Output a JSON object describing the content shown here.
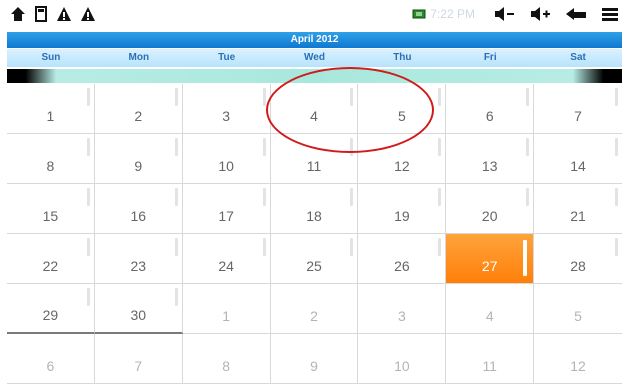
{
  "status_bar": {
    "left_icons": [
      "home-icon",
      "sd-card-icon",
      "warning-icon",
      "warning-icon"
    ],
    "time": "7:22 PM",
    "right_icons": [
      "volume-down-icon",
      "volume-up-icon",
      "back-icon",
      "menu-icon"
    ]
  },
  "calendar": {
    "month_title": "April 2012",
    "weekdays": [
      "Sun",
      "Mon",
      "Tue",
      "Wed",
      "Thu",
      "Fri",
      "Sat"
    ],
    "weeks": [
      [
        "1",
        "2",
        "3",
        "4",
        "5",
        "6",
        "7"
      ],
      [
        "8",
        "9",
        "10",
        "11",
        "12",
        "13",
        "14"
      ],
      [
        "15",
        "16",
        "17",
        "18",
        "19",
        "20",
        "21"
      ],
      [
        "22",
        "23",
        "24",
        "25",
        "26",
        "27",
        "28"
      ],
      [
        "29",
        "30",
        "1",
        "2",
        "3",
        "4",
        "5"
      ],
      [
        "6",
        "7",
        "8",
        "9",
        "10",
        "11",
        "12"
      ]
    ],
    "today": "27",
    "colors": {
      "header_blue": "#1a86d8",
      "weekday_text": "#2a6fb8",
      "today_orange": "#ff8a14",
      "annotation_red": "#d11a1a"
    }
  }
}
